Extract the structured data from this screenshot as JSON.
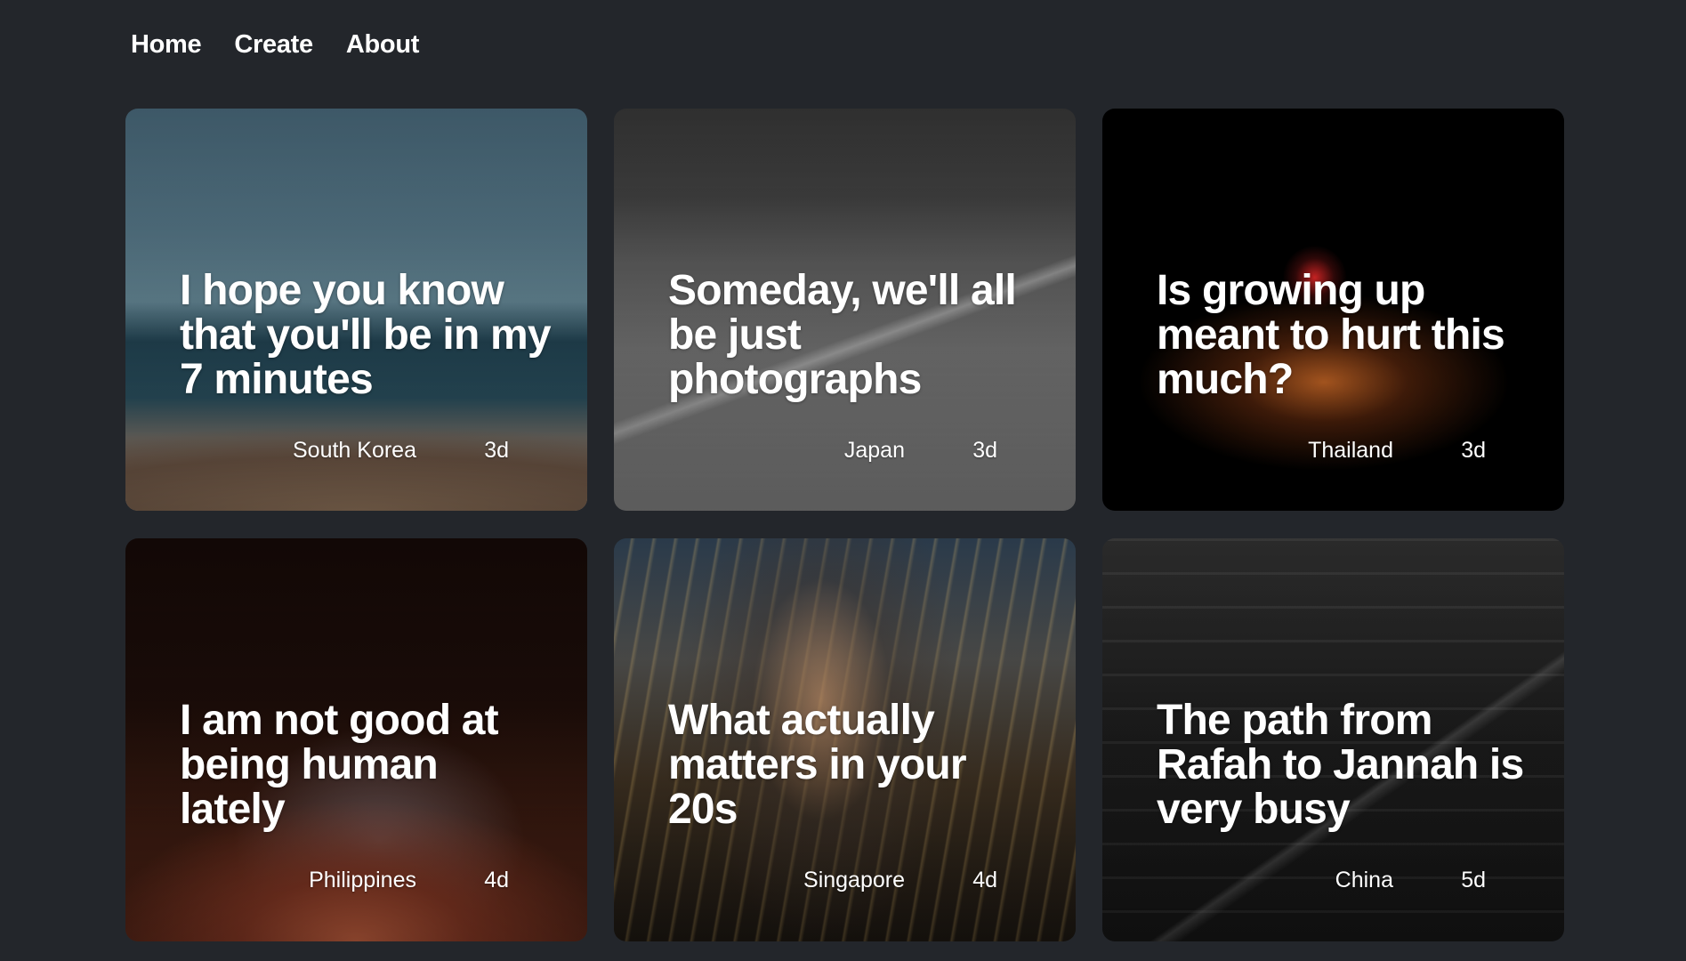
{
  "nav": {
    "home": "Home",
    "create": "Create",
    "about": "About"
  },
  "posts": [
    {
      "title": "I hope you know that you'll be in my 7 minutes",
      "country": "South Korea",
      "age": "3d",
      "image": "beach-sea-photo"
    },
    {
      "title": "Someday, we'll all be just photographs",
      "country": "Japan",
      "age": "3d",
      "image": "street-crossing-photo"
    },
    {
      "title": "Is growing up meant to hurt this much?",
      "country": "Thailand",
      "age": "3d",
      "image": "night-vendor-photo"
    },
    {
      "title": "I am not good at being human lately",
      "country": "Philippines",
      "age": "4d",
      "image": "cinema-seat-photo"
    },
    {
      "title": "What actually matters in your 20s",
      "country": "Singapore",
      "age": "4d",
      "image": "city-lights-photo"
    },
    {
      "title": "The path from Rafah to Jannah is very busy",
      "country": "China",
      "age": "5d",
      "image": "stairs-railing-photo"
    }
  ]
}
